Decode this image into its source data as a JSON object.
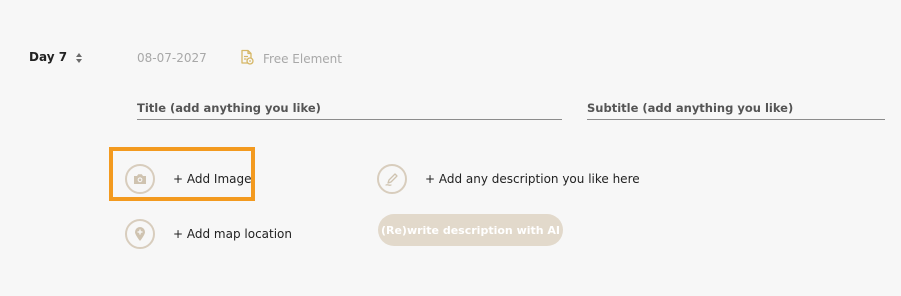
{
  "day": {
    "label": "Day 7"
  },
  "date": "08-07-2027",
  "element_type": {
    "label": "Free Element",
    "icon": "document-settings-icon"
  },
  "fields": {
    "title_placeholder": "Title (add anything you like)",
    "subtitle_placeholder": "Subtitle (add anything you like)"
  },
  "actions": {
    "add_image": "+ Add Image",
    "add_map": "+ Add map location",
    "add_description": "+ Add any description you like here",
    "rewrite_ai": "(Re)write description with AI"
  },
  "colors": {
    "accent_highlight": "#f39a1f",
    "icon_ring": "#d8cdbd",
    "ai_button_bg": "#e2d9cb"
  }
}
